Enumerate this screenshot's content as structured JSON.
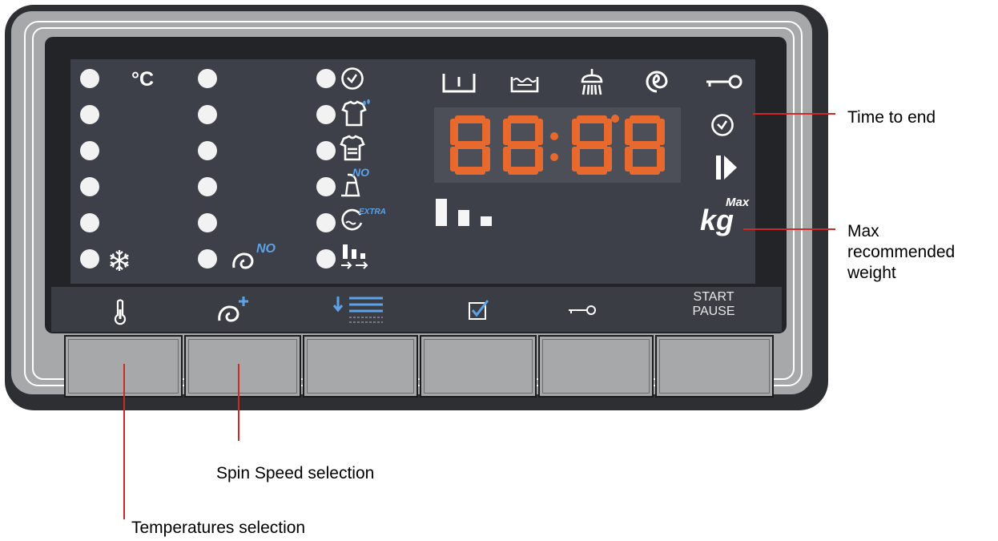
{
  "panel": {
    "temperature_unit": "°C",
    "spin_no_label": "NO",
    "option_no_label": "NO",
    "option_extra_label": "EXTRA",
    "kg_label": "kg",
    "max_label": "Max",
    "start_label": "START",
    "pause_label": "PAUSE"
  },
  "callouts": {
    "time_to_end": "Time to end",
    "max_weight_line1": "Max",
    "max_weight_line2": "recommended",
    "max_weight_line3": "weight",
    "spin_speed": "Spin Speed selection",
    "temperatures": "Temperatures selection"
  },
  "colors": {
    "digit_segments": "#e8692d",
    "accent_blue": "#5da2e6",
    "callout_line": "#cc2929"
  }
}
